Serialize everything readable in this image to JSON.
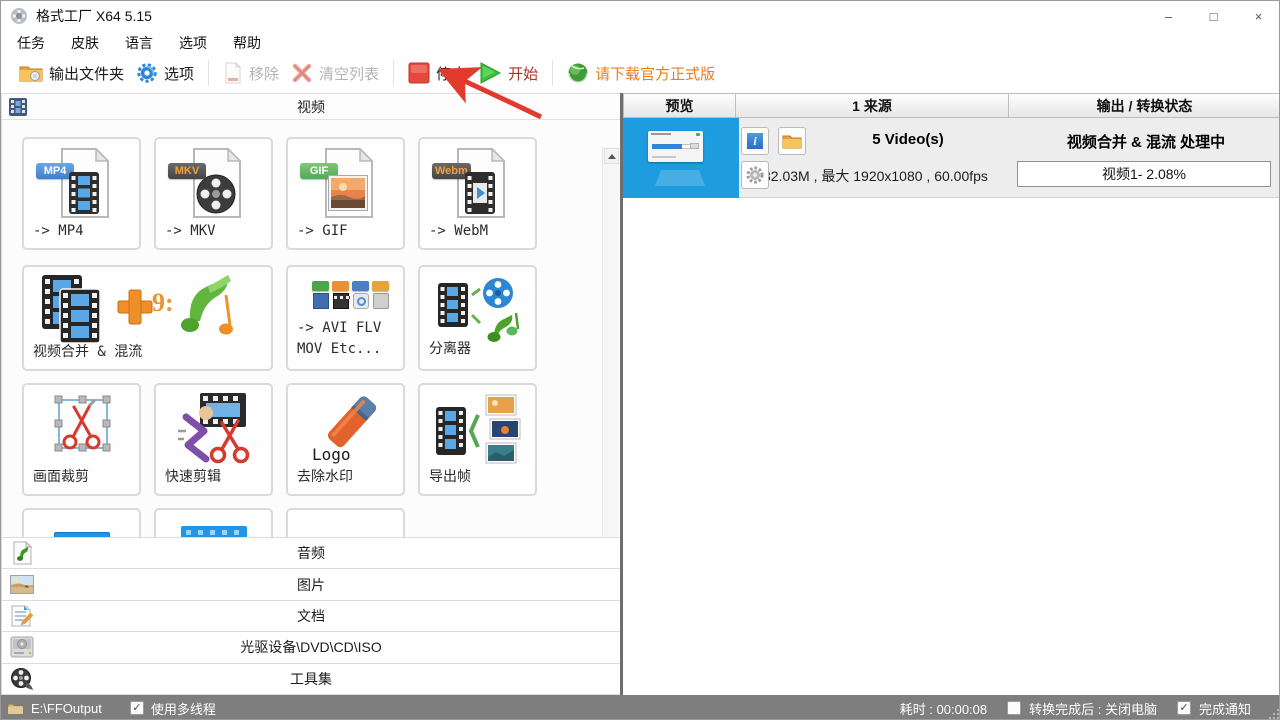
{
  "window": {
    "title": "格式工厂 X64 5.15",
    "controls": {
      "minimize": "–",
      "maximize": "□",
      "close": "×"
    }
  },
  "menu": {
    "items": [
      "任务",
      "皮肤",
      "语言",
      "选项",
      "帮助"
    ]
  },
  "toolbar": {
    "output_folder": "输出文件夹",
    "options": "选项",
    "remove": "移除",
    "clear_list": "清空列表",
    "stop": "停止",
    "start": "开始",
    "download_official": "请下载官方正式版"
  },
  "video_panel": {
    "title": "视频",
    "tiles": [
      {
        "label": "-> MP4",
        "badge": "MP4"
      },
      {
        "label": "-> MKV",
        "badge": "MKV"
      },
      {
        "label": "-> GIF",
        "badge": "GIF"
      },
      {
        "label": "-> WebM",
        "badge": "Webm"
      },
      {
        "label": "视频合并 & 混流"
      },
      {
        "label": "-> AVI FLV MOV Etc..."
      },
      {
        "label": "分离器"
      },
      {
        "label": "画面裁剪"
      },
      {
        "label": "快速剪辑"
      },
      {
        "label": "去除水印",
        "icon_text": "Logo"
      },
      {
        "label": "导出帧"
      }
    ]
  },
  "categories": [
    {
      "label": "音频"
    },
    {
      "label": "图片"
    },
    {
      "label": "文档"
    },
    {
      "label": "光驱设备\\DVD\\CD\\ISO"
    },
    {
      "label": "工具集"
    }
  ],
  "task_panel": {
    "headers": [
      "预览",
      "1 来源",
      "输出 / 转换状态"
    ],
    "task": {
      "source_count": "5 Video(s)",
      "source_info": "32.03M , 最大 1920x1080 , 60.00fps",
      "status_title": "视频合并 & 混流 处理中",
      "progress_text": "视频1- 2.08%"
    }
  },
  "statusbar": {
    "output_path": "E:\\FFOutput",
    "multithread_label": "使用多线程",
    "elapsed": "耗时 : 00:00:08",
    "shutdown_label": "转换完成后 : 关闭电脑",
    "notify_label": "完成通知",
    "check_glyph": "✓"
  },
  "colors": {
    "selection_blue": "#1e9ce0",
    "start_green": "#3dbf3d",
    "stop_red": "#e5493d",
    "link_orange": "#e87e1e",
    "arrow_red": "#e23b2e"
  }
}
